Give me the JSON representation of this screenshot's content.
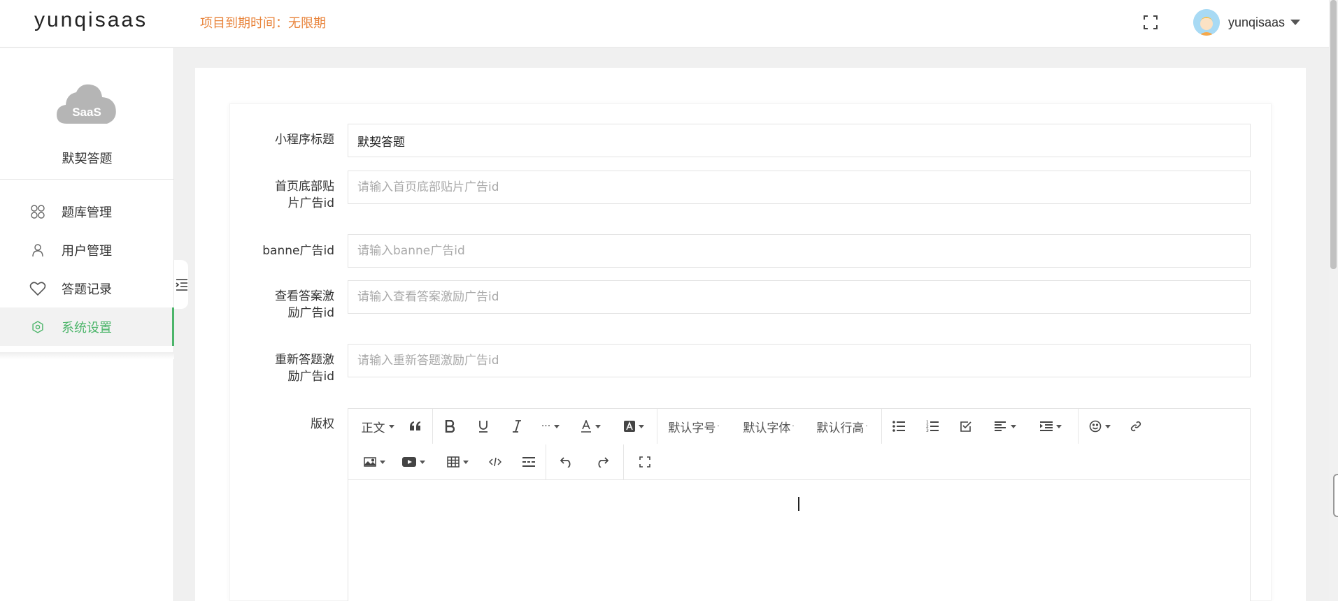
{
  "header": {
    "logo": "yunqisaas",
    "expire_text": "项目到期时间：无限期",
    "username": "yunqisaas"
  },
  "sidebar": {
    "logo_text": "SaaS",
    "app_name": "默契答题",
    "items": [
      {
        "label": "题库管理",
        "icon": "apps-icon"
      },
      {
        "label": "用户管理",
        "icon": "user-icon"
      },
      {
        "label": "答题记录",
        "icon": "heart-icon"
      },
      {
        "label": "系统设置",
        "icon": "gear-icon",
        "active": true
      }
    ]
  },
  "form": {
    "title": {
      "label": "小程序标题",
      "value": "默契答题"
    },
    "banner_bottom": {
      "label_line1": "首页底部贴",
      "label_line2": "片广告id",
      "placeholder": "请输入首页底部贴片广告id"
    },
    "banner": {
      "label": "banne广告id",
      "placeholder": "请输入banne广告id"
    },
    "answer_reward": {
      "label_line1": "查看答案激",
      "label_line2": "励广告id",
      "placeholder": "请输入查看答案激励广告id"
    },
    "retry_reward": {
      "label_line1": "重新答题激",
      "label_line2": "励广告id",
      "placeholder": "请输入重新答题激励广告id"
    },
    "copyright": {
      "label": "版权"
    }
  },
  "editor": {
    "paragraph": "正文",
    "font_size": "默认字号",
    "font_family": "默认字体",
    "line_height": "默认行高",
    "more": "···"
  },
  "colors": {
    "accent": "#4cb56a",
    "expire": "#e8833a"
  }
}
